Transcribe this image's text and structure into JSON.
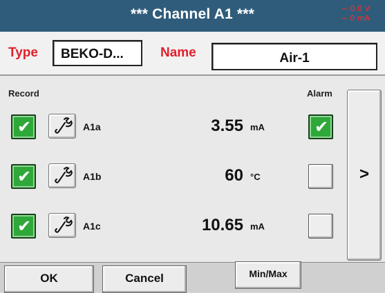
{
  "title": "***   Channel A1   ***",
  "status": {
    "line1": "~ 0.0 V",
    "line2": "~ 0 mA"
  },
  "type_field": {
    "label": "Type",
    "value": "BEKO-D..."
  },
  "name_field": {
    "label": "Name",
    "value": "Air-1"
  },
  "headers": {
    "record": "Record",
    "alarm": "Alarm"
  },
  "rows": [
    {
      "label": "A1a",
      "value": "3.55",
      "unit": "mA",
      "record": true,
      "alarm": true
    },
    {
      "label": "A1b",
      "value": "60",
      "unit": "°C",
      "record": true,
      "alarm": false
    },
    {
      "label": "A1c",
      "value": "10.65",
      "unit": "mA",
      "record": true,
      "alarm": false
    }
  ],
  "next_label": ">",
  "footer": {
    "ok": "OK",
    "cancel": "Cancel",
    "minmax": "Min/Max"
  },
  "icons": {
    "check": "checkmark-icon",
    "wrench": "wrench-icon"
  },
  "colors": {
    "titlebar": "#2f5c7a",
    "accent_red": "#e0202c",
    "check_green": "#2fa83a"
  }
}
